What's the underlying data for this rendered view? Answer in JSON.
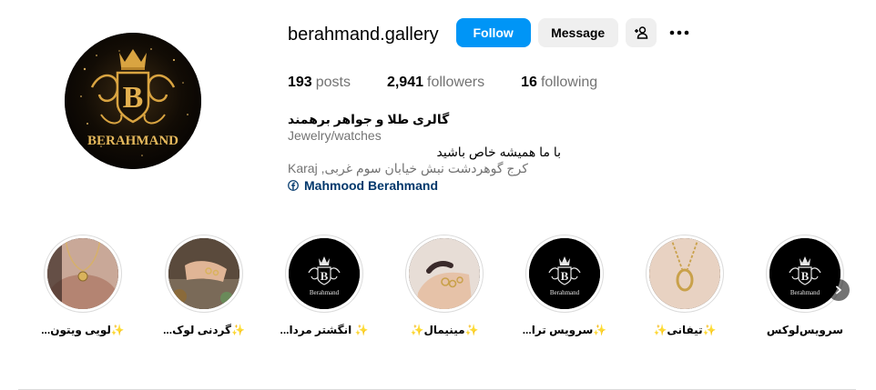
{
  "profile": {
    "username": "berahmand.gallery",
    "avatar_icon": "berahmand-crown-logo",
    "brand_color": "#d9a441"
  },
  "actions": {
    "follow_label": "Follow",
    "message_label": "Message",
    "suggest_icon": "person-add-icon",
    "more_icon": "more-horizontal-icon",
    "follow_color": "#0095f6"
  },
  "stats": {
    "posts_count": "193",
    "posts_label": "posts",
    "followers_count": "2,941",
    "followers_label": "followers",
    "following_count": "16",
    "following_label": "following"
  },
  "bio": {
    "name": "گالری طلا و جواهر برهمند",
    "category": "Jewelry/watches",
    "tagline": "با ما همیشه خاص باشید",
    "address": "Karaj ,کرج گوهردشت نبش خیابان سوم غربی",
    "link_icon": "facebook-icon",
    "link_text": "Mahmood Berahmand"
  },
  "highlights": [
    {
      "label": "✨لویی ویتون...",
      "kind": "photo-necklace"
    },
    {
      "label": "✨گردنی لوک...",
      "kind": "photo-hand"
    },
    {
      "label": "✨ انگشتر مردا...",
      "kind": "logo"
    },
    {
      "label": "✨مینیمال✨",
      "kind": "photo-rings"
    },
    {
      "label": "✨سرویس ترا...",
      "kind": "logo"
    },
    {
      "label": "✨تیفانی✨",
      "kind": "photo-pendant"
    },
    {
      "label": "سرویس‌لوکس",
      "kind": "logo"
    }
  ],
  "logo_text": "BERAHMAND",
  "logo_text_small": "Berahmand"
}
